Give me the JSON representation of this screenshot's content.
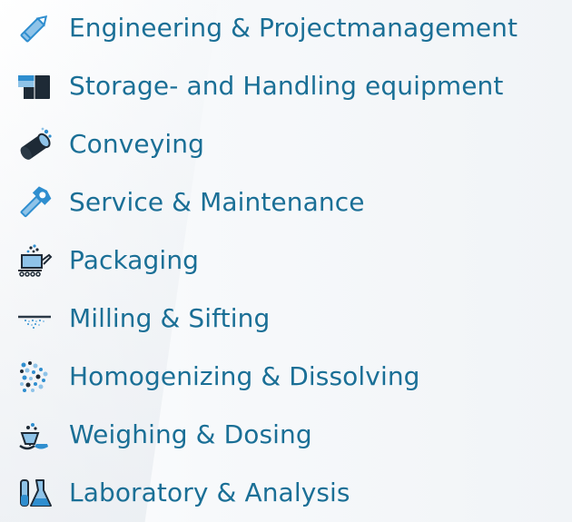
{
  "colors": {
    "label": "#1a6f96",
    "icon_dark": "#1e2a36",
    "icon_blue": "#2f8ecf",
    "icon_light": "#8fc3e8"
  },
  "menu": {
    "items": [
      {
        "label": "Engineering & Projectmanagement",
        "icon": "pencil-icon"
      },
      {
        "label": "Storage- and Handling equipment",
        "icon": "container-icon"
      },
      {
        "label": "Conveying",
        "icon": "pipe-icon"
      },
      {
        "label": "Service & Maintenance",
        "icon": "wrench-icon"
      },
      {
        "label": "Packaging",
        "icon": "packaging-icon"
      },
      {
        "label": "Milling & Sifting",
        "icon": "sieve-icon"
      },
      {
        "label": "Homogenizing & Dissolving",
        "icon": "particles-icon"
      },
      {
        "label": "Weighing & Dosing",
        "icon": "scale-icon"
      },
      {
        "label": "Laboratory & Analysis",
        "icon": "lab-flask-icon"
      }
    ]
  }
}
